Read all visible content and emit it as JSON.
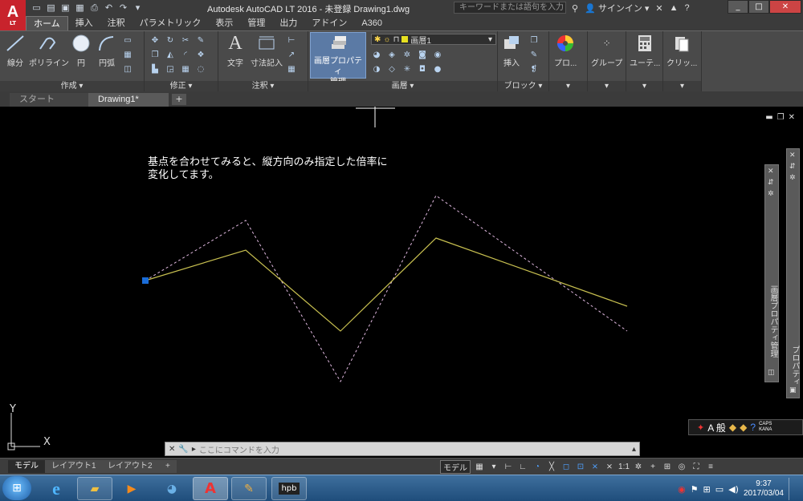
{
  "app": {
    "logo_text": "A",
    "logo_sub": "LT",
    "window_title": "Autodesk AutoCAD LT 2016 - 未登録    Drawing1.dwg",
    "search_placeholder": "キーワードまたは語句を入力",
    "signin": "サインイン"
  },
  "ribbon_tabs": [
    "ホーム",
    "挿入",
    "注釈",
    "パラメトリック",
    "表示",
    "管理",
    "出力",
    "アドイン",
    "A360"
  ],
  "panels": {
    "draw": {
      "title": "作成 ▾",
      "tools": [
        "線分",
        "ポリライン",
        "円",
        "円弧"
      ]
    },
    "modify": {
      "title": "修正 ▾"
    },
    "annotation": {
      "title": "注釈 ▾",
      "tools": [
        "文字",
        "寸法記入"
      ]
    },
    "layers": {
      "title": "画層 ▾",
      "properties_tool": "画層プロパティ\n管理",
      "current_layer": "画層1",
      "layer_color": "#e6e020"
    },
    "block": {
      "title": "ブロック ▾",
      "tools": [
        "挿入"
      ]
    },
    "others": [
      "プロ...",
      "グループ",
      "ユーテ...",
      "クリッ..."
    ]
  },
  "doc_tabs": [
    "スタート",
    "Drawing1*"
  ],
  "canvas": {
    "note_line1": "基点を合わせてみると、縦方向のみ指定した倍率に",
    "note_line2": "変化してます。",
    "ucs_y": "Y",
    "ucs_x": "X",
    "properties_palette_label": "画層プロパティ管理",
    "properties2_label": "プロパティ",
    "yellow_color": "#c8c050",
    "dashed_color": "#e0b8e0",
    "grip_color": "#1a6cd8"
  },
  "command_line": {
    "prompt_icon": "▸",
    "placeholder": "ここにコマンドを入力"
  },
  "ime": {
    "mode": "A 般",
    "caps": "CAPS",
    "kana": "KANA"
  },
  "layout_tabs": [
    "モデル",
    "レイアウト1",
    "レイアウト2"
  ],
  "status": {
    "model": "モデル",
    "scale": "1:1"
  },
  "taskbar": {
    "time": "9:37",
    "date": "2017/03/04"
  }
}
